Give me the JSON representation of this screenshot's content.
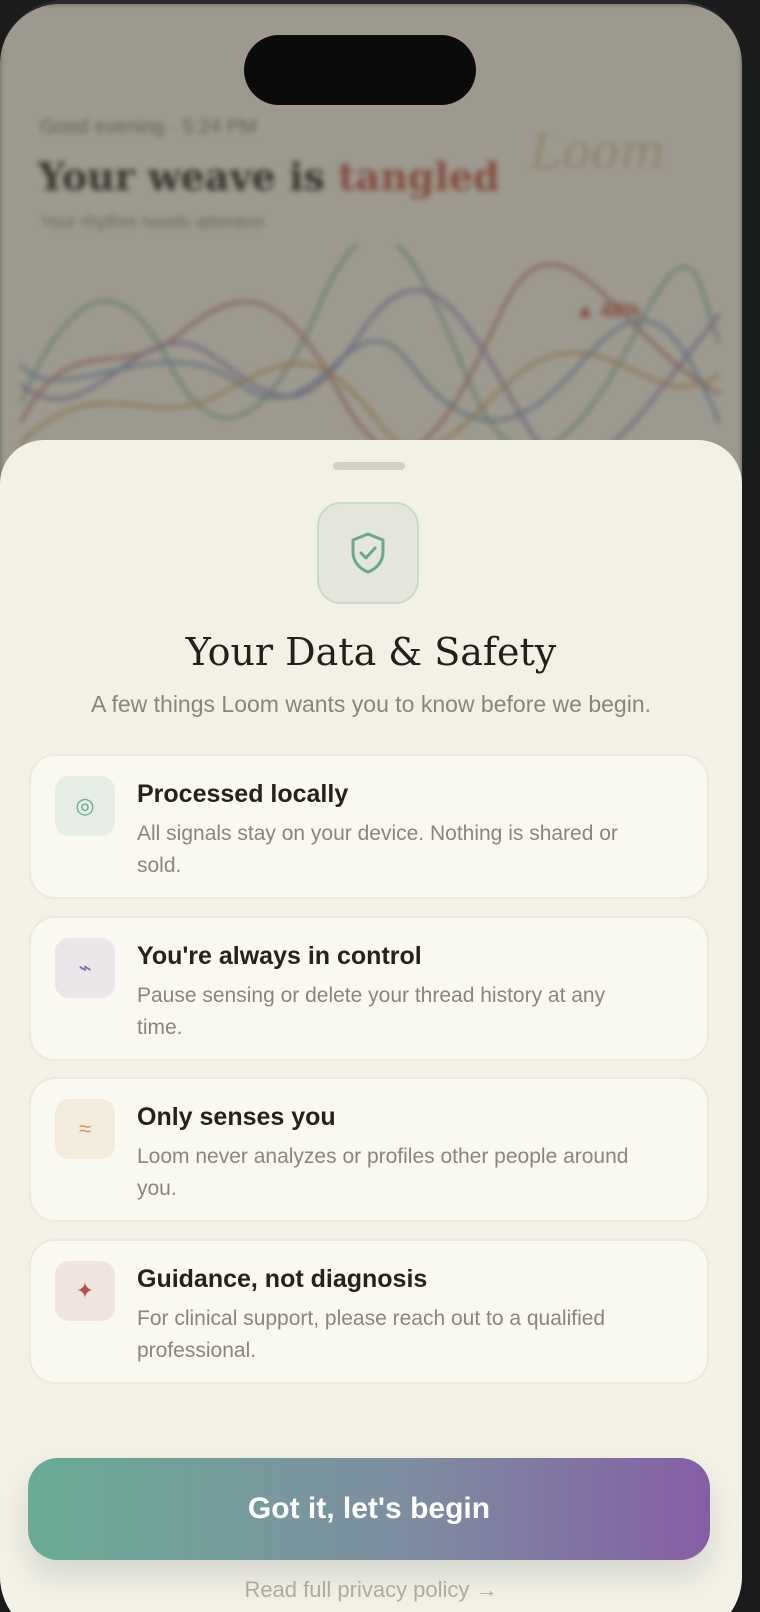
{
  "background": {
    "greeting": "Good evening · 5:24 PM",
    "title_prefix": "Your weave is",
    "title_accent": "tangled",
    "subtitle": "Your rhythm needs attention",
    "logo": "Loom",
    "badge": "▲ 48%"
  },
  "sheet": {
    "title": "Your Data & Safety",
    "subtitle": "A few things Loom wants you to know before we begin.",
    "icon": "shield-check-icon",
    "cards": [
      {
        "icon": "concentric-circle-icon",
        "glyph": "◎",
        "title": "Processed locally",
        "line1": "All signals stay on your device. Nothing is shared or",
        "line2": "sold."
      },
      {
        "icon": "lightning-icon",
        "glyph": "⌁",
        "title": "You're always in control",
        "line1": "Pause sensing or delete your thread history at any",
        "line2": "time."
      },
      {
        "icon": "waves-icon",
        "glyph": "≈",
        "title": "Only senses you",
        "line1": "Loom never analyzes or profiles other people around",
        "line2": "you."
      },
      {
        "icon": "sparkle-icon",
        "glyph": "✦",
        "title": "Guidance, not diagnosis",
        "line1": "For clinical support, please reach out to a qualified",
        "line2": "professional."
      }
    ],
    "cta_label": "Got it, let's begin",
    "privacy_link": "Read full privacy policy →"
  },
  "colors": {
    "sheet_bg": "#f3f1e6",
    "accent_green": "#6aab95",
    "accent_purple": "#845ea4",
    "accent_red": "#c0564a"
  }
}
